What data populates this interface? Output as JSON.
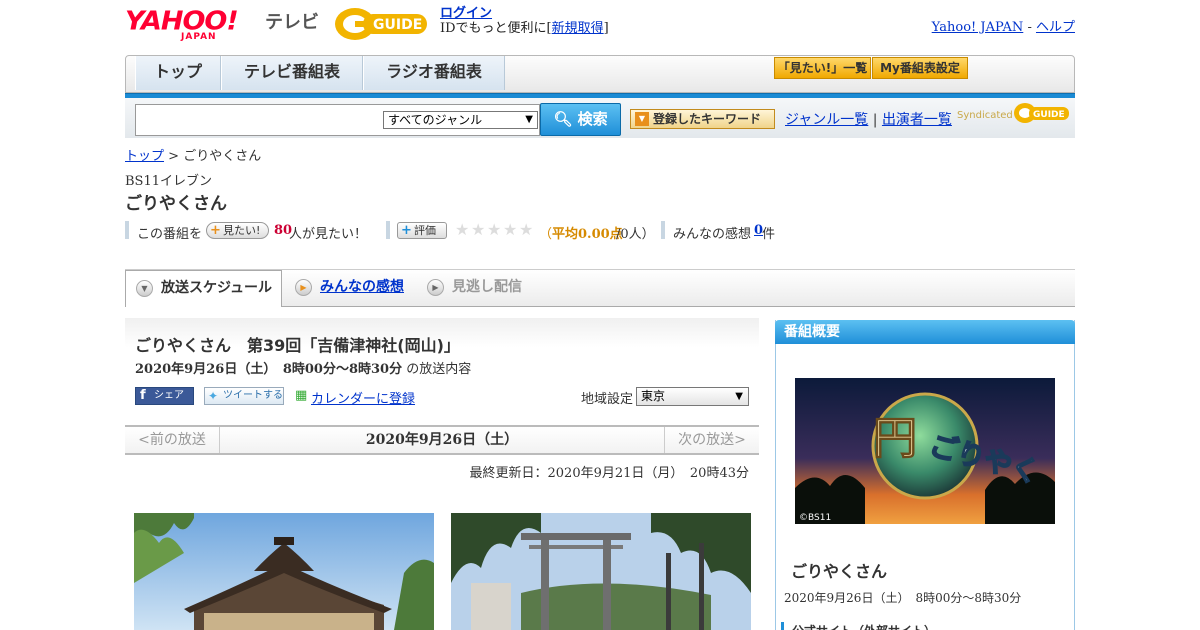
{
  "header": {
    "yahoo_logo": "YAHOO!",
    "yahoo_japan": "JAPAN",
    "tv_label": "テレビ",
    "gguide_logo": "G-GUIDE",
    "login_label": "ログイン",
    "login_prompt": "IDでもっと便利に[",
    "signup_label": "新規取得",
    "signup_close": "]",
    "yahoo_japan_link": "Yahoo! JAPAN",
    "separator": "-",
    "help_link": "ヘルプ"
  },
  "nav": {
    "tabs": [
      {
        "label": "トップ"
      },
      {
        "label": "テレビ番組表"
      },
      {
        "label": "ラジオ番組表"
      }
    ],
    "watchlist_button": "「見たい!」一覧",
    "my_schedule_button": "My番組表設定"
  },
  "search": {
    "input_value": "",
    "genre_selected": "すべてのジャンル",
    "search_button": "検索",
    "keyword_button": "登録したキーワード",
    "genre_list_link": "ジャンル一覧",
    "link_separator": "|",
    "cast_list_link": "出演者一覧",
    "syndicated": "Syndicated"
  },
  "breadcrumb": {
    "top_link": "トップ",
    "sep": ">",
    "current": "ごりやくさん"
  },
  "program": {
    "channel": "BS11イレブン",
    "title": "ごりやくさん"
  },
  "stats": {
    "this_program": "この番組を",
    "want_to_watch_button": "見たい!",
    "want_count": "80",
    "want_suffix": "人が見たい！",
    "rating_button": "評価",
    "stars": "★",
    "rating_open": "（",
    "rating_avg_label": "平均0.00点",
    "rating_count": "/0人）",
    "impressions_label": "みんなの感想",
    "impressions_count": "0",
    "impressions_suffix": "件",
    "rating_value": 0
  },
  "tabs": [
    {
      "label": "放送スケジュール"
    },
    {
      "label": "みんなの感想"
    },
    {
      "label": "見逃し配信"
    }
  ],
  "episode": {
    "title": "ごりやくさん　第39回「吉備津神社(岡山)」",
    "date_time": "2020年9月26日（土）　8時00分～8時30分",
    "date_suffix": "の放送内容",
    "fb_share": "シェア",
    "tweet": "ツイートする",
    "calendar_link": "カレンダーに登録",
    "region_label": "地域設定",
    "region_selected": "東京"
  },
  "datenav": {
    "prev": "<前の放送",
    "current": "2020年9月26日（土）",
    "next": "次の放送>"
  },
  "updated": "最終更新日：2020年9月21日（月）　20時43分",
  "sidebar": {
    "heading": "番組概要",
    "image_caption": "©BS11",
    "logo_text": "ごりやく",
    "title": "ごりやくさん",
    "time": "2020年9月26日（土）　8時00分～8時30分",
    "official_site": "公式サイト（外部サイト）"
  },
  "colors": {
    "yahoo_red": "#ff0033",
    "link_blue": "#0033cc",
    "accent_blue": "#1f8fd8",
    "gold": "#f0a800",
    "count_red": "#cc0033",
    "rating_orange": "#d68a00"
  }
}
